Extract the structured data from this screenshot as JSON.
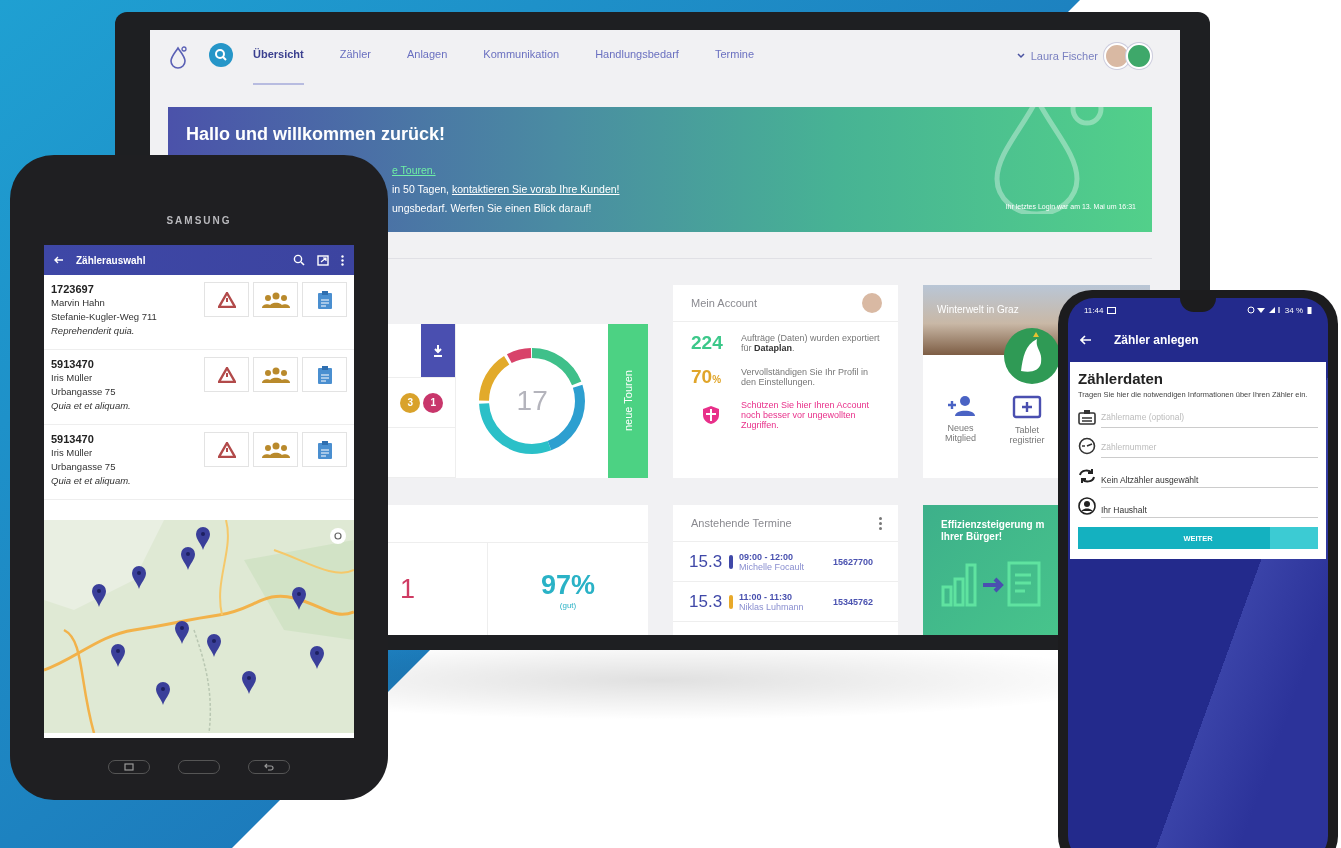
{
  "monitor": {
    "nav": {
      "tabs": [
        {
          "label": "Übersicht",
          "selected": true
        },
        {
          "label": "Zähler",
          "selected": false
        },
        {
          "label": "Anlagen",
          "selected": false
        },
        {
          "label": "Kommunikation",
          "selected": false
        },
        {
          "label": "Handlungsbedarf",
          "selected": false
        },
        {
          "label": "Termine",
          "selected": false
        }
      ],
      "user_name": "Laura Fischer"
    },
    "banner": {
      "title": "Hallo und willkommen zurück!",
      "lines": [
        {
          "kind": "link",
          "link": "e Touren."
        },
        {
          "kind": "mixed",
          "text": "in 50 Tagen, ",
          "link": "kontaktieren Sie vorab Ihre Kunden!"
        },
        {
          "kind": "plain",
          "text": "ungsbedarf. Werfen Sie einen Blick darauf!"
        }
      ],
      "last_login": "Ihr letztes Login war am 13. Mai um 16:31"
    },
    "tours_card": {
      "badges": [
        {
          "label": "3",
          "color": "#d9a22b"
        },
        {
          "label": "1",
          "color": "#c8366b"
        }
      ],
      "total": "17",
      "action": "neue Touren"
    },
    "account_card": {
      "title": "Mein Account",
      "items": [
        {
          "kind": "stat",
          "value": "224",
          "color": "#3cc88a",
          "text": "Aufträge (Daten) wurden exportiert für **Dataplan**."
        },
        {
          "kind": "stat",
          "value": "70",
          "unit": "%",
          "color": "#e0a52a",
          "text": "Vervollständigen Sie Ihr Profil in den Einstellungen."
        },
        {
          "kind": "alert",
          "text": "Schützen Sie hier Ihren Account noch besser vor ungewollten Zugriffen."
        }
      ]
    },
    "city_card": {
      "title": "Winterwelt in Graz",
      "actions": [
        {
          "label": "Neues Mitglied"
        },
        {
          "label": "Tablet registrier"
        }
      ]
    },
    "stats_card": {
      "values": [
        {
          "value": "1",
          "color": "#cf3b63"
        },
        {
          "value": "97%",
          "caption": "(gut)",
          "color": "#2ab2c6"
        }
      ]
    },
    "appointments_card": {
      "title": "Anstehende Termine",
      "items": [
        {
          "date": "15.3",
          "time": "09:00 - 12:00",
          "name": "Michelle Focault",
          "number": "15627700",
          "color": "#3f48a8"
        },
        {
          "date": "15.3",
          "time": "11:00 - 11:30",
          "name": "Niklas Luhmann",
          "number": "15345762",
          "color": "#e8a92a"
        }
      ]
    },
    "promo_card": {
      "lines": [
        "Effizienzsteigerung m",
        "Ihrer Bürger!"
      ]
    }
  },
  "tablet": {
    "brand": "SAMSUNG",
    "title": "Zählerauswahl",
    "meters": [
      {
        "number": "1723697",
        "name": "Marvin Hahn",
        "street": "Stefanie-Kugler-Weg 711",
        "note": "Reprehenderit quia."
      },
      {
        "number": "5913470",
        "name": "Iris Müller",
        "street": "Urbangasse 75",
        "note": "Quia et et aliquam."
      },
      {
        "number": "5913470",
        "name": "Iris Müller",
        "street": "Urbangasse 75",
        "note": "Quia et et aliquam."
      }
    ]
  },
  "phone": {
    "status_time": "11:44",
    "battery": "34 %",
    "title": "Zähler anlegen",
    "heading": "Zählerdaten",
    "intro": "Tragen Sie hier die notwendigen Informationen über Ihren Zähler ein.",
    "fields": [
      {
        "kind": "input",
        "placeholder": "Zählername (optional)"
      },
      {
        "kind": "input",
        "placeholder": "Zählernummer"
      },
      {
        "kind": "select",
        "value": "Kein Altzähler ausgewählt"
      },
      {
        "kind": "select",
        "value": "Ihr Haushalt"
      }
    ],
    "button": "WEITER"
  }
}
